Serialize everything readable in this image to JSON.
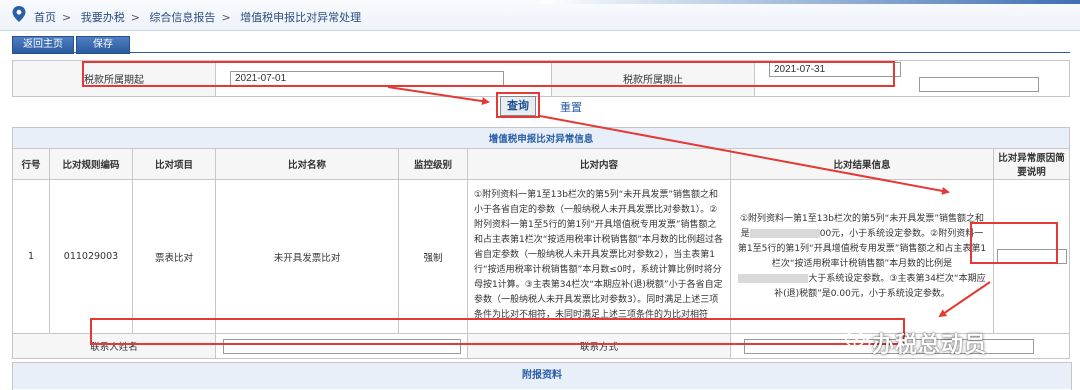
{
  "breadcrumb": [
    "首页",
    "我要办税",
    "综合信息报告",
    "增值税申报比对异常处理"
  ],
  "breadcrumb_sep": ">",
  "toolbar": {
    "back_label": "返回主页",
    "save_label": "保存"
  },
  "period": {
    "start_label": "税款所属期起",
    "start_value": "2021-07-01",
    "end_label": "税款所属期止",
    "end_value": "2021-07-31"
  },
  "actions": {
    "query_label": "查询",
    "reset_label": "重置"
  },
  "anomaly": {
    "title": "增值税申报比对异常信息",
    "headers": [
      "行号",
      "比对规则编码",
      "比对项目",
      "比对名称",
      "监控级别",
      "比对内容",
      "比对结果信息",
      "比对异常原因简要说明"
    ],
    "row": {
      "no": "1",
      "code": "011029003",
      "item": "票表比对",
      "name": "未开具发票比对",
      "level": "强制",
      "content": "①附列资料一第1至13b栏次的第5列“未开具发票”销售额之和小于各省自定的参数（一般纳税人未开具发票比对参数1）。②附列资料一第1至5行的第1列“开具增值税专用发票”销售额之和占主表第1栏次“按适用税率计税销售额”本月数的比例超过各省自定参数（一般纳税人未开具发票比对参数2），当主表第1行“按适用税率计税销售额”本月数≤0时，系统计算比例时将分母按1计算。③主表第34栏次“本期应补(退)税额”小于各省自定参数（一般纳税人未开具发票比对参数3）。同时满足上述三项条件为比对不相符，未同时满足上述三项条件的为比对相符",
      "result_a": "①附列资料一第1至13b栏次的第5列“未开具发票”销售额之和是",
      "result_b": "00元，小于系统设定参数。②附列资料一第1至5行的第1列“开具增值税专用发票”销售额之和占主表第1栏次“按适用税率计税销售额”本月数的比例是",
      "result_c": "大于系统设定参数。③主表第34栏次“本期应补(退)税额”是0.00元，小于系统设定参数。",
      "reason": ""
    },
    "contact_name_label": "联系人姓名",
    "contact_name_value": "",
    "contact_method_label": "联系方式",
    "contact_method_value": ""
  },
  "attachments": {
    "title": "附报资料"
  },
  "watermark": "办税总动员",
  "colors": {
    "annotation": "#e53935",
    "accent": "#2a5ea6",
    "header_bg": "#e8eff8"
  }
}
